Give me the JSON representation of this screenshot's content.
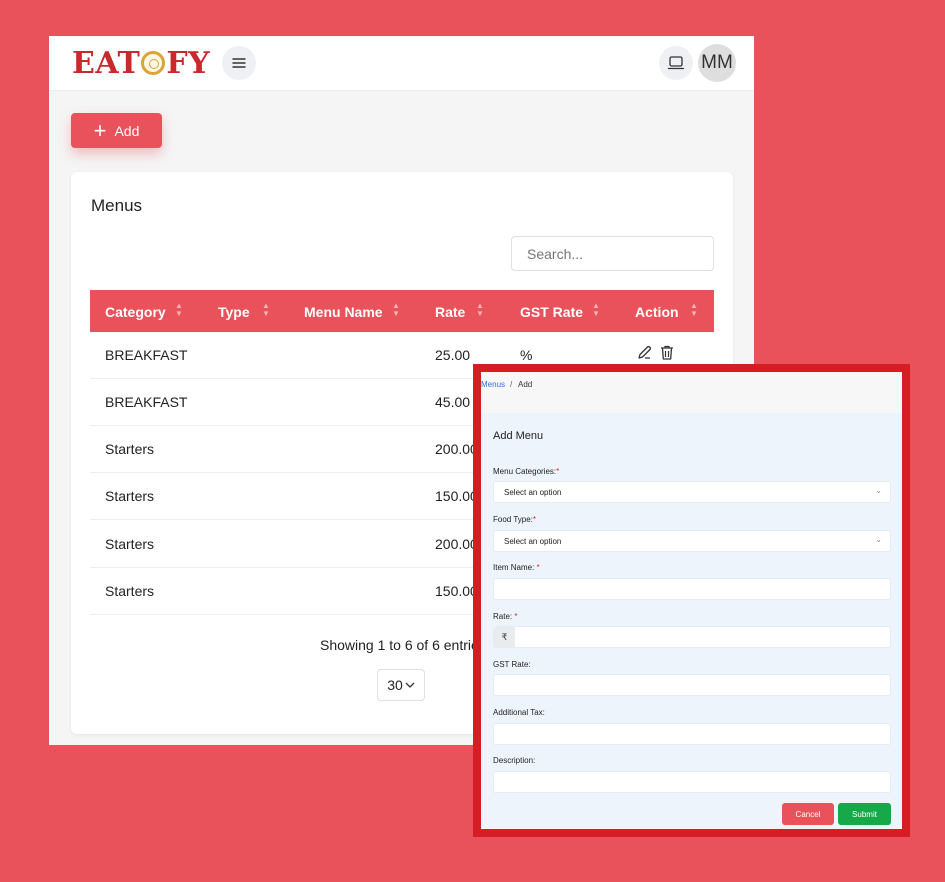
{
  "brand": {
    "logo_text_left": "EAT",
    "logo_text_right": "FY"
  },
  "header": {
    "avatar_initials": "MM"
  },
  "toolbar": {
    "add_label": "Add"
  },
  "menus_card": {
    "title": "Menus",
    "search_placeholder": "Search...",
    "columns": [
      "Category",
      "Type",
      "Menu Name",
      "Rate",
      "GST Rate",
      "Action"
    ],
    "rows": [
      {
        "category": "BREAKFAST",
        "type": "",
        "menu_name": "",
        "rate": "25.00",
        "gst_rate": "%"
      },
      {
        "category": "BREAKFAST",
        "type": "",
        "menu_name": "",
        "rate": "45.00",
        "gst_rate": ""
      },
      {
        "category": "Starters",
        "type": "",
        "menu_name": "",
        "rate": "200.00",
        "gst_rate": ""
      },
      {
        "category": "Starters",
        "type": "",
        "menu_name": "",
        "rate": "150.00",
        "gst_rate": ""
      },
      {
        "category": "Starters",
        "type": "",
        "menu_name": "",
        "rate": "200.00",
        "gst_rate": ""
      },
      {
        "category": "Starters",
        "type": "",
        "menu_name": "",
        "rate": "150.00",
        "gst_rate": ""
      }
    ],
    "showing_text": "Showing 1 to 6 of 6 entries",
    "page_size": "30"
  },
  "add_form": {
    "breadcrumb": {
      "parent": "Menus",
      "separator": "/",
      "current": "Add"
    },
    "title": "Add Menu",
    "menu_categories_label": "Menu Categories:",
    "menu_categories_value": "Select an option",
    "food_type_label": "Food Type:",
    "food_type_value": "Select an option",
    "item_name_label": "Item Name:",
    "rate_label": "Rate:",
    "rate_prefix": "₹",
    "gst_rate_label": "GST Rate:",
    "additional_tax_label": "Additional Tax:",
    "description_label": "Description:",
    "required_mark": "*",
    "cancel_label": "Cancel",
    "submit_label": "Submit"
  },
  "colors": {
    "accent": "#e9525a",
    "overlay_border": "#d41e24",
    "submit": "#17a84a",
    "link": "#3b6fd6"
  }
}
